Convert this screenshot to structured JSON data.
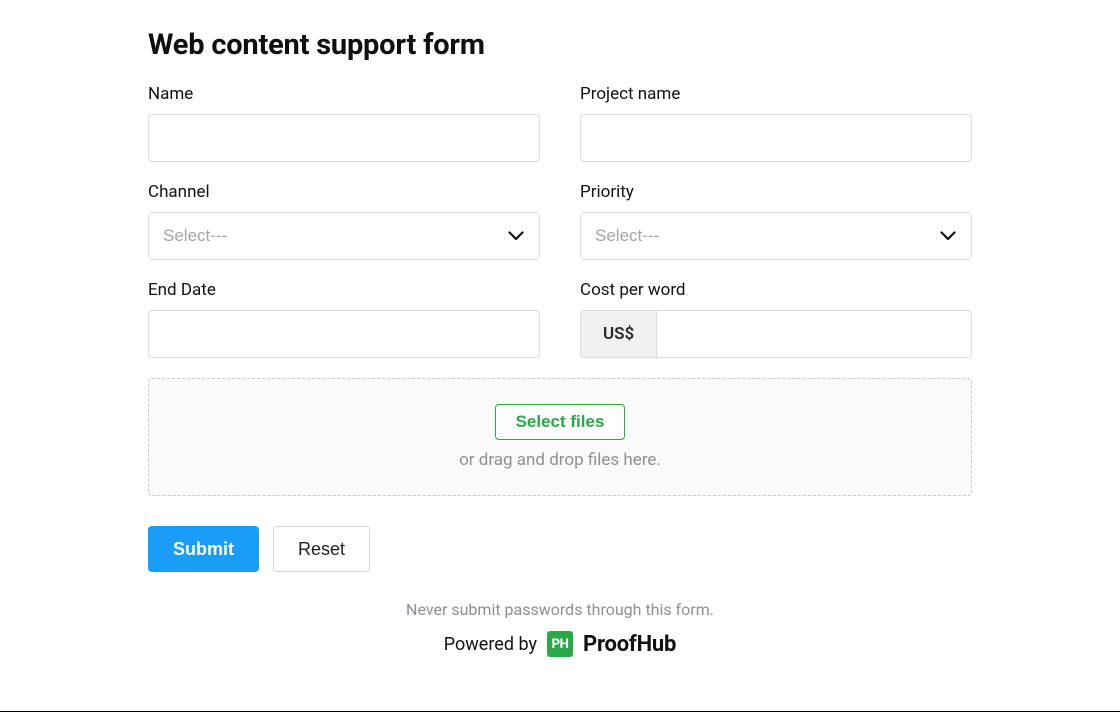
{
  "form": {
    "title": "Web content support form",
    "fields": {
      "name": {
        "label": "Name",
        "value": ""
      },
      "project_name": {
        "label": "Project name",
        "value": ""
      },
      "channel": {
        "label": "Channel",
        "placeholder": "Select---"
      },
      "priority": {
        "label": "Priority",
        "placeholder": "Select---"
      },
      "end_date": {
        "label": "End Date",
        "value": ""
      },
      "cost_per_word": {
        "label": "Cost per word",
        "currency_prefix": "US$",
        "value": ""
      }
    },
    "upload": {
      "button_label": "Select files",
      "hint": "or drag and drop files here."
    },
    "actions": {
      "submit": "Submit",
      "reset": "Reset"
    }
  },
  "footer": {
    "warning": "Never submit passwords through this form.",
    "powered_by_label": "Powered by",
    "brand_badge": "PH",
    "brand_name": "ProofHub"
  }
}
